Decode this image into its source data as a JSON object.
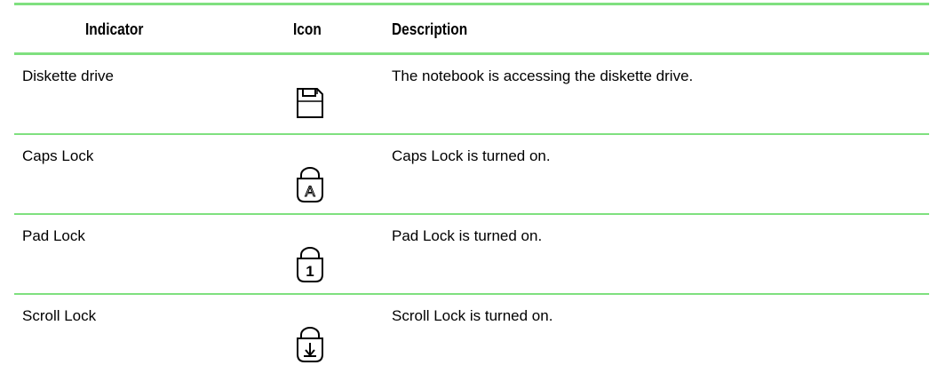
{
  "header": {
    "indicator": "Indicator",
    "icon": "Icon",
    "description": "Description"
  },
  "rows": [
    {
      "indicator": "Diskette drive",
      "icon": "diskette-icon",
      "description": "The notebook is accessing the diskette drive."
    },
    {
      "indicator": "Caps Lock",
      "icon": "caps-lock-icon",
      "icon_text": "A",
      "description": "Caps Lock is turned on."
    },
    {
      "indicator": "Pad Lock",
      "icon": "pad-lock-icon",
      "icon_text": "1",
      "description": "Pad Lock is turned on."
    },
    {
      "indicator": "Scroll Lock",
      "icon": "scroll-lock-icon",
      "description": "Scroll Lock is turned on."
    }
  ],
  "colors": {
    "rule": "#7fe07f"
  }
}
